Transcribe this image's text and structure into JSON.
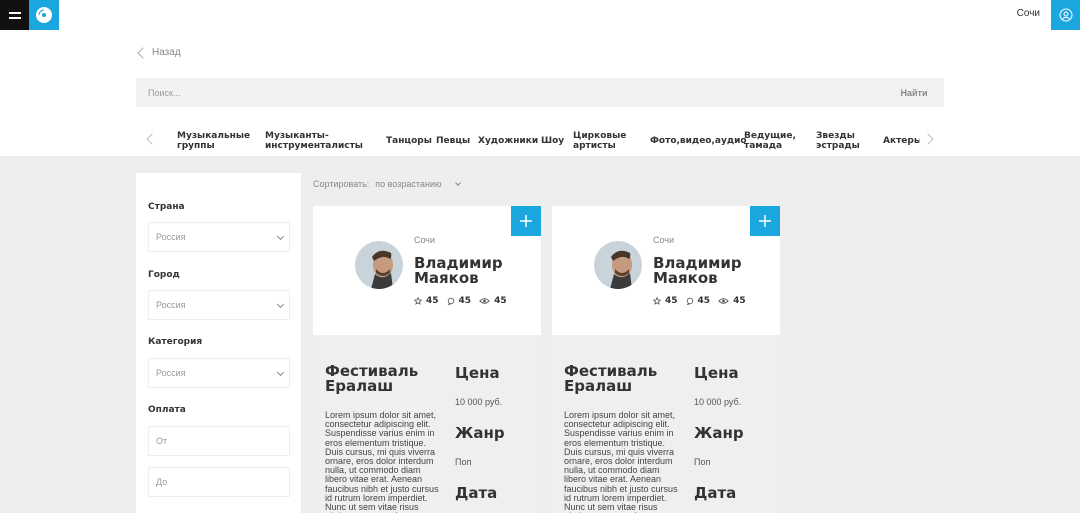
{
  "header": {
    "city": "Сочи",
    "menu_icon": "hamburger-icon",
    "logo_icon": "disc-icon",
    "user_icon": "user-icon"
  },
  "nav": {
    "back_label": "Назад"
  },
  "search": {
    "placeholder": "Поиск...",
    "button_label": "Найти"
  },
  "categories": [
    "Музыкальные группы",
    "Музыканты-инструменталисты",
    "Танцоры",
    "Певцы",
    "Художники",
    "Шоу",
    "Цирковые артисты",
    "Фото,видео,аудио",
    "Ведущие, тамада",
    "Звезды эстрады",
    "Актеры"
  ],
  "filters": {
    "country_label": "Страна",
    "country_value": "Россия",
    "city_label": "Город",
    "city_value": "Россия",
    "category_label": "Категория",
    "category_value": "Россия",
    "payment_label": "Оплата",
    "from_placeholder": "От",
    "to_placeholder": "До"
  },
  "sort": {
    "label": "Сортировать:",
    "value": "по возрастанию"
  },
  "cards": [
    {
      "city": "Сочи",
      "name": "Владимир Маяков",
      "rating": "45",
      "comments": "45",
      "views": "45",
      "event_title": "Фестиваль Ералаш",
      "description": "Lorem ipsum dolor sit amet, consectetur adipiscing elit. Suspendisse varius enim in eros elementum tristique. Duis cursus, mi quis viverra ornare, eros dolor interdum nulla, ut commodo diam libero vitae erat. Aenean faucibus nibh et justo cursus id rutrum lorem imperdiet. Nunc ut sem vitae risus tristique posuere Aenean",
      "price_label": "Цена",
      "price_value": "10 000 руб.",
      "genre_label": "Жанр",
      "genre_value": "Поп",
      "date_label": "Дата"
    },
    {
      "city": "Сочи",
      "name": "Владимир Маяков",
      "rating": "45",
      "comments": "45",
      "views": "45",
      "event_title": "Фестиваль Ералаш",
      "description": "Lorem ipsum dolor sit amet, consectetur adipiscing elit. Suspendisse varius enim in eros elementum tristique. Duis cursus, mi quis viverra ornare, eros dolor interdum nulla, ut commodo diam libero vitae erat. Aenean faucibus nibh et justo cursus id rutrum lorem imperdiet. Nunc ut sem vitae risus tristique posuere Aenean",
      "price_label": "Цена",
      "price_value": "10 000 руб.",
      "genre_label": "Жанр",
      "genre_value": "Поп",
      "date_label": "Дата"
    }
  ],
  "colors": {
    "accent": "#1aa7e0",
    "gray_bg": "#eeeeee",
    "dark": "#111111"
  }
}
